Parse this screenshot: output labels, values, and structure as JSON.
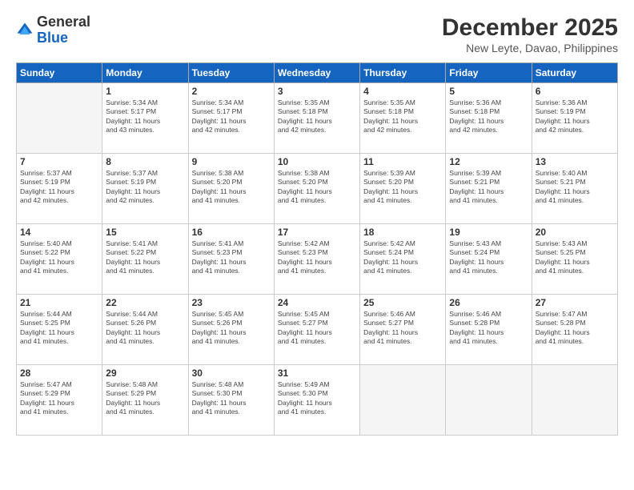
{
  "logo": {
    "general": "General",
    "blue": "Blue"
  },
  "title": "December 2025",
  "subtitle": "New Leyte, Davao, Philippines",
  "days_of_week": [
    "Sunday",
    "Monday",
    "Tuesday",
    "Wednesday",
    "Thursday",
    "Friday",
    "Saturday"
  ],
  "weeks": [
    [
      {
        "day": "",
        "info": ""
      },
      {
        "day": "1",
        "info": "Sunrise: 5:34 AM\nSunset: 5:17 PM\nDaylight: 11 hours\nand 43 minutes."
      },
      {
        "day": "2",
        "info": "Sunrise: 5:34 AM\nSunset: 5:17 PM\nDaylight: 11 hours\nand 42 minutes."
      },
      {
        "day": "3",
        "info": "Sunrise: 5:35 AM\nSunset: 5:18 PM\nDaylight: 11 hours\nand 42 minutes."
      },
      {
        "day": "4",
        "info": "Sunrise: 5:35 AM\nSunset: 5:18 PM\nDaylight: 11 hours\nand 42 minutes."
      },
      {
        "day": "5",
        "info": "Sunrise: 5:36 AM\nSunset: 5:18 PM\nDaylight: 11 hours\nand 42 minutes."
      },
      {
        "day": "6",
        "info": "Sunrise: 5:36 AM\nSunset: 5:19 PM\nDaylight: 11 hours\nand 42 minutes."
      }
    ],
    [
      {
        "day": "7",
        "info": "Sunrise: 5:37 AM\nSunset: 5:19 PM\nDaylight: 11 hours\nand 42 minutes."
      },
      {
        "day": "8",
        "info": "Sunrise: 5:37 AM\nSunset: 5:19 PM\nDaylight: 11 hours\nand 42 minutes."
      },
      {
        "day": "9",
        "info": "Sunrise: 5:38 AM\nSunset: 5:20 PM\nDaylight: 11 hours\nand 41 minutes."
      },
      {
        "day": "10",
        "info": "Sunrise: 5:38 AM\nSunset: 5:20 PM\nDaylight: 11 hours\nand 41 minutes."
      },
      {
        "day": "11",
        "info": "Sunrise: 5:39 AM\nSunset: 5:20 PM\nDaylight: 11 hours\nand 41 minutes."
      },
      {
        "day": "12",
        "info": "Sunrise: 5:39 AM\nSunset: 5:21 PM\nDaylight: 11 hours\nand 41 minutes."
      },
      {
        "day": "13",
        "info": "Sunrise: 5:40 AM\nSunset: 5:21 PM\nDaylight: 11 hours\nand 41 minutes."
      }
    ],
    [
      {
        "day": "14",
        "info": "Sunrise: 5:40 AM\nSunset: 5:22 PM\nDaylight: 11 hours\nand 41 minutes."
      },
      {
        "day": "15",
        "info": "Sunrise: 5:41 AM\nSunset: 5:22 PM\nDaylight: 11 hours\nand 41 minutes."
      },
      {
        "day": "16",
        "info": "Sunrise: 5:41 AM\nSunset: 5:23 PM\nDaylight: 11 hours\nand 41 minutes."
      },
      {
        "day": "17",
        "info": "Sunrise: 5:42 AM\nSunset: 5:23 PM\nDaylight: 11 hours\nand 41 minutes."
      },
      {
        "day": "18",
        "info": "Sunrise: 5:42 AM\nSunset: 5:24 PM\nDaylight: 11 hours\nand 41 minutes."
      },
      {
        "day": "19",
        "info": "Sunrise: 5:43 AM\nSunset: 5:24 PM\nDaylight: 11 hours\nand 41 minutes."
      },
      {
        "day": "20",
        "info": "Sunrise: 5:43 AM\nSunset: 5:25 PM\nDaylight: 11 hours\nand 41 minutes."
      }
    ],
    [
      {
        "day": "21",
        "info": "Sunrise: 5:44 AM\nSunset: 5:25 PM\nDaylight: 11 hours\nand 41 minutes."
      },
      {
        "day": "22",
        "info": "Sunrise: 5:44 AM\nSunset: 5:26 PM\nDaylight: 11 hours\nand 41 minutes."
      },
      {
        "day": "23",
        "info": "Sunrise: 5:45 AM\nSunset: 5:26 PM\nDaylight: 11 hours\nand 41 minutes."
      },
      {
        "day": "24",
        "info": "Sunrise: 5:45 AM\nSunset: 5:27 PM\nDaylight: 11 hours\nand 41 minutes."
      },
      {
        "day": "25",
        "info": "Sunrise: 5:46 AM\nSunset: 5:27 PM\nDaylight: 11 hours\nand 41 minutes."
      },
      {
        "day": "26",
        "info": "Sunrise: 5:46 AM\nSunset: 5:28 PM\nDaylight: 11 hours\nand 41 minutes."
      },
      {
        "day": "27",
        "info": "Sunrise: 5:47 AM\nSunset: 5:28 PM\nDaylight: 11 hours\nand 41 minutes."
      }
    ],
    [
      {
        "day": "28",
        "info": "Sunrise: 5:47 AM\nSunset: 5:29 PM\nDaylight: 11 hours\nand 41 minutes."
      },
      {
        "day": "29",
        "info": "Sunrise: 5:48 AM\nSunset: 5:29 PM\nDaylight: 11 hours\nand 41 minutes."
      },
      {
        "day": "30",
        "info": "Sunrise: 5:48 AM\nSunset: 5:30 PM\nDaylight: 11 hours\nand 41 minutes."
      },
      {
        "day": "31",
        "info": "Sunrise: 5:49 AM\nSunset: 5:30 PM\nDaylight: 11 hours\nand 41 minutes."
      },
      {
        "day": "",
        "info": ""
      },
      {
        "day": "",
        "info": ""
      },
      {
        "day": "",
        "info": ""
      }
    ]
  ]
}
